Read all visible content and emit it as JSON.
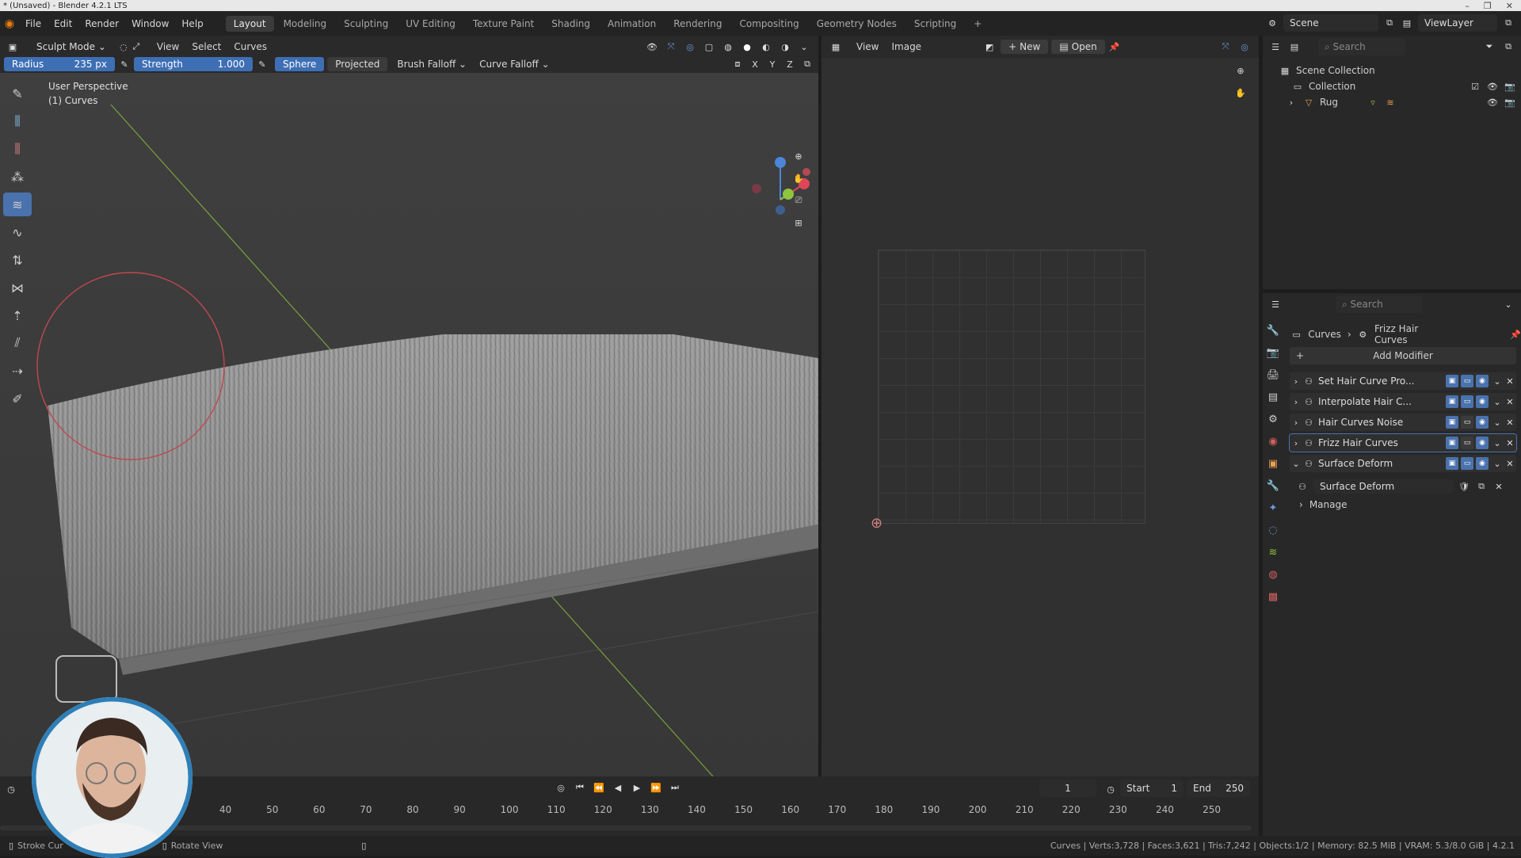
{
  "window": {
    "title": "* (Unsaved) - Blender 4.2.1 LTS"
  },
  "menu": [
    "File",
    "Edit",
    "Render",
    "Window",
    "Help"
  ],
  "workspaces": [
    "Layout",
    "Modeling",
    "Sculpting",
    "UV Editing",
    "Texture Paint",
    "Shading",
    "Animation",
    "Rendering",
    "Compositing",
    "Geometry Nodes",
    "Scripting"
  ],
  "active_workspace": "Layout",
  "scene": {
    "name": "Scene",
    "view_layer": "ViewLayer"
  },
  "viewport": {
    "mode": "Sculpt Mode",
    "menus": [
      "View",
      "Select",
      "Curves"
    ],
    "overlay_title": "User Perspective",
    "overlay_sub": "(1) Curves",
    "tool": {
      "radius_label": "Radius",
      "radius_value": "235 px",
      "strength_label": "Strength",
      "strength_value": "1.000",
      "sphere_label": "Sphere",
      "projected_label": "Projected",
      "brush_falloff": "Brush Falloff",
      "curve_falloff": "Curve Falloff",
      "axes": [
        "X",
        "Y",
        "Z"
      ]
    },
    "brush_color": "#c0474f"
  },
  "image_editor": {
    "menus": [
      "View",
      "Image"
    ],
    "new_label": "New",
    "open_label": "Open"
  },
  "outliner": {
    "search_placeholder": "Search",
    "root": "Scene Collection",
    "collection": "Collection",
    "object": "Rug"
  },
  "properties": {
    "search_placeholder": "Search",
    "breadcrumb": [
      "Curves",
      "Frizz Hair Curves"
    ],
    "add_modifier": "Add Modifier",
    "modifiers": [
      "Set Hair Curve Pro...",
      "Interpolate Hair C...",
      "Hair Curves Noise",
      "Frizz Hair Curves",
      "Surface Deform"
    ],
    "surface_deform_node": "Surface Deform",
    "manage_label": "Manage"
  },
  "timeline": {
    "current_frame": "1",
    "start_label": "Start",
    "start_value": "1",
    "end_label": "End",
    "end_value": "250",
    "ticks": [
      "40",
      "50",
      "60",
      "70",
      "80",
      "90",
      "100",
      "110",
      "120",
      "130",
      "140",
      "150",
      "160",
      "170",
      "180",
      "190",
      "200",
      "210",
      "220",
      "230",
      "240",
      "250"
    ]
  },
  "status": {
    "left_action": "Stroke Cur",
    "mid_action": "Rotate View",
    "stats": "Curves | Verts:3,728 | Faces:3,621 | Tris:7,242 | Objects:1/2 | Memory: 82.5 MiB | VRAM: 5.3/8.0 GiB | 4.2.1"
  },
  "colors": {
    "accent": "#4a72ad",
    "axis_x": "#e0455a",
    "axis_y": "#8fc53c",
    "axis_z": "#4b86d8"
  }
}
